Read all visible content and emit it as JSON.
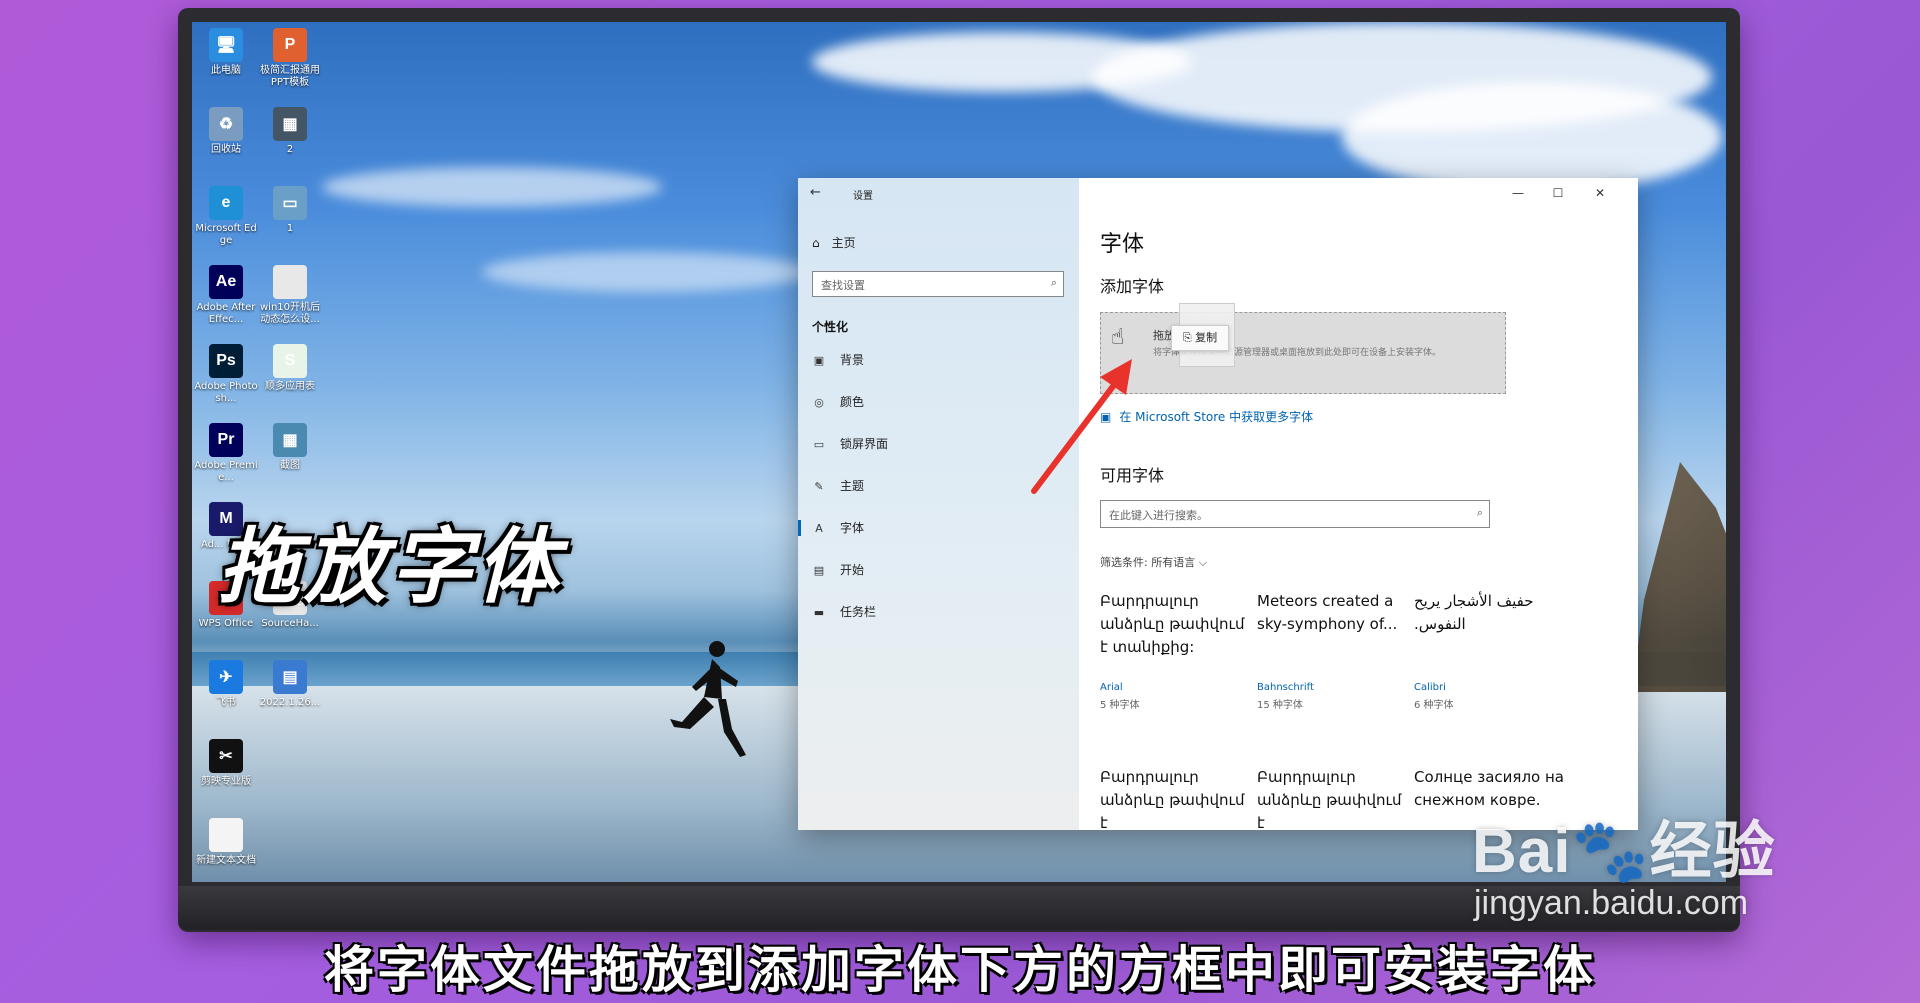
{
  "desktop": {
    "icons": [
      {
        "label": "此电脑",
        "color": "#2a8de0",
        "glyph": "🖥"
      },
      {
        "label": "极简汇报通用PPT模板",
        "color": "#e06030",
        "glyph": "P"
      },
      {
        "label": "回收站",
        "color": "#7a9cc0",
        "glyph": "♻"
      },
      {
        "label": "2",
        "color": "#445566",
        "glyph": "▦"
      },
      {
        "label": "Microsoft Edge",
        "color": "#1f8fd6",
        "glyph": "e"
      },
      {
        "label": "1",
        "color": "#6aa0c8",
        "glyph": "▭"
      },
      {
        "label": "Adobe After Effec...",
        "color": "#00005b",
        "glyph": "Ae"
      },
      {
        "label": "win10开机后动态怎么设...",
        "color": "#e8e8e8",
        "glyph": ""
      },
      {
        "label": "Adobe Photosh...",
        "color": "#001e36",
        "glyph": "Ps"
      },
      {
        "label": "顺多应用表",
        "color": "#e8f4e8",
        "glyph": "S"
      },
      {
        "label": "Adobe Premie...",
        "color": "#00005b",
        "glyph": "Pr"
      },
      {
        "label": "截图",
        "color": "#4a8ab0",
        "glyph": "▦"
      },
      {
        "label": "Ad... Me...",
        "color": "#1a1a6b",
        "glyph": "M"
      },
      {
        "label": "WPS Office",
        "color": "#d42a2a",
        "glyph": "W"
      },
      {
        "label": "SourceHa...",
        "color": "#e8e8e8",
        "glyph": "Abg"
      },
      {
        "label": "飞书",
        "color": "#1a7ae0",
        "glyph": "✈"
      },
      {
        "label": "2022.1.26...",
        "color": "#3a7ad0",
        "glyph": "▤"
      },
      {
        "label": "剪映专业版",
        "color": "#111111",
        "glyph": "✂"
      },
      {
        "label": "新建文本文档",
        "color": "#f4f4f4",
        "glyph": ""
      }
    ]
  },
  "overlay_title": "拖放字体",
  "settings": {
    "window_title": "设置",
    "back_icon": "←",
    "controls": {
      "minimize": "—",
      "maximize": "☐",
      "close": "✕"
    },
    "nav": {
      "home": "主页",
      "search_placeholder": "查找设置",
      "section": "个性化",
      "items": [
        {
          "icon": "▣",
          "label": "背景"
        },
        {
          "icon": "◎",
          "label": "颜色"
        },
        {
          "icon": "▭",
          "label": "锁屏界面"
        },
        {
          "icon": "✎",
          "label": "主题"
        },
        {
          "icon": "A",
          "label": "字体"
        },
        {
          "icon": "▤",
          "label": "开始"
        },
        {
          "icon": "▬",
          "label": "任务栏"
        }
      ],
      "active_index": 4
    },
    "content": {
      "heading": "字体",
      "add_heading": "添加字体",
      "dropzone_title": "拖放",
      "dropzone_desc": "将字体文件从文件资源管理器或桌面拖放到此处即可在设备上安装字体。",
      "copy_tooltip": "复制",
      "store_link": "在 Microsoft Store 中获取更多字体",
      "available_heading": "可用字体",
      "font_search_placeholder": "在此键入进行搜索。",
      "filter_label": "筛选条件: 所有语言 ⌵",
      "fonts": [
        {
          "sample": "Բարդրալուր անձրևը թափվում է տանիքից:",
          "name": "Arial",
          "count": "5 种字体"
        },
        {
          "sample": "Meteors created a sky-symphony of...",
          "name": "Bahnschrift",
          "count": "15 种字体"
        },
        {
          "sample": "حفيف الأشجار يريح النفوس.",
          "name": "Calibri",
          "count": "6 种字体"
        },
        {
          "sample": "Բարդրալուր անձրևը թափվում է",
          "name": "",
          "count": ""
        },
        {
          "sample": "Բարդրալուր անձրևը թափվում է",
          "name": "",
          "count": ""
        },
        {
          "sample": "Солнце засияло на снежном ковре.",
          "name": "",
          "count": ""
        }
      ]
    }
  },
  "subtitle": "将字体文件拖放到添加字体下方的方框中即可安装字体",
  "watermark": {
    "main": "Bai🐾经验",
    "sub": "jingyan.baidu.com"
  },
  "colors": {
    "accent": "#0067c0",
    "link": "#0063b1",
    "arrow": "#e8322c"
  }
}
